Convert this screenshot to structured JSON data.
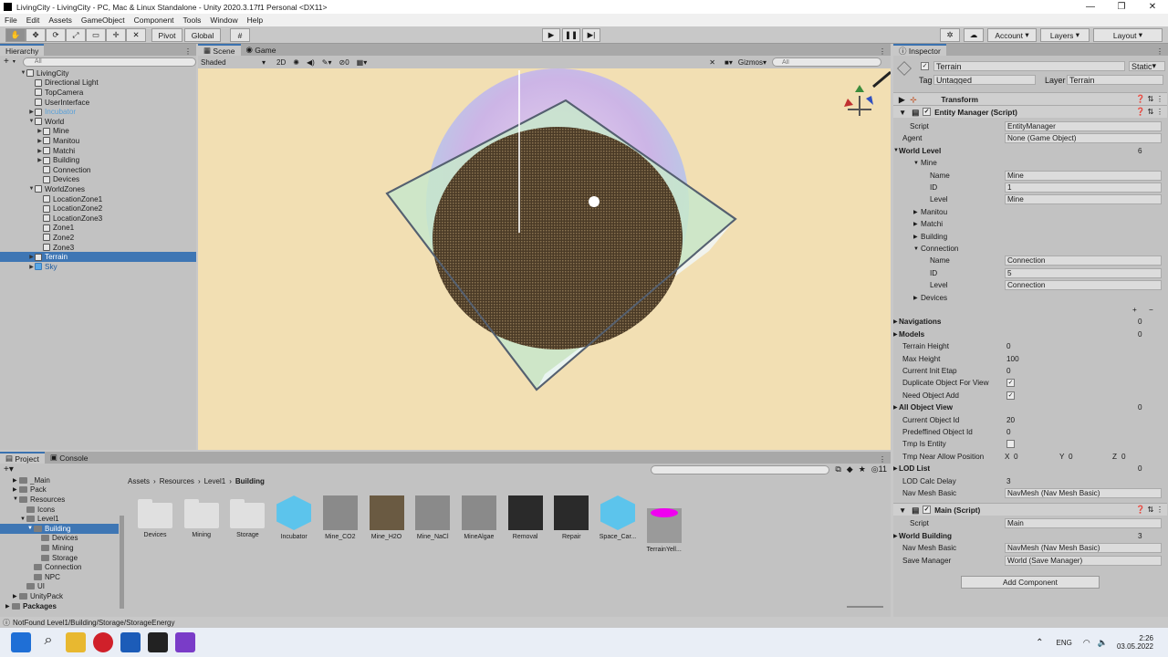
{
  "window": {
    "title": "LivingCity - LivingCity - PC, Mac & Linux Standalone - Unity 2020.3.17f1 Personal <DX11>",
    "minimize": "—",
    "maximize": "❐",
    "close": "✕"
  },
  "menu": [
    "File",
    "Edit",
    "Assets",
    "GameObject",
    "Component",
    "Tools",
    "Window",
    "Help"
  ],
  "toolbar": {
    "pivot": "Pivot",
    "global": "Global",
    "account": "Account",
    "layers": "Layers",
    "layout": "Layout"
  },
  "hierarchy": {
    "tab": "Hierarchy",
    "search_placeholder": "All",
    "rows": [
      {
        "label": "LivingCity",
        "indent": 0,
        "arrow": "▼",
        "type": "scene"
      },
      {
        "label": "Directional Light",
        "indent": 1,
        "arrow": "",
        "type": "obj"
      },
      {
        "label": "TopCamera",
        "indent": 1,
        "arrow": "",
        "type": "obj"
      },
      {
        "label": "UserInterface",
        "indent": 1,
        "arrow": "",
        "type": "obj"
      },
      {
        "label": "Incubator",
        "indent": 1,
        "arrow": "▶",
        "type": "faded"
      },
      {
        "label": "World",
        "indent": 1,
        "arrow": "▼",
        "type": "obj"
      },
      {
        "label": "Mine",
        "indent": 2,
        "arrow": "▶",
        "type": "obj"
      },
      {
        "label": "Manitou",
        "indent": 2,
        "arrow": "▶",
        "type": "obj"
      },
      {
        "label": "Matchi",
        "indent": 2,
        "arrow": "▶",
        "type": "obj"
      },
      {
        "label": "Building",
        "indent": 2,
        "arrow": "▶",
        "type": "obj"
      },
      {
        "label": "Connection",
        "indent": 2,
        "arrow": "",
        "type": "obj"
      },
      {
        "label": "Devices",
        "indent": 2,
        "arrow": "",
        "type": "obj"
      },
      {
        "label": "WorldZones",
        "indent": 1,
        "arrow": "▼",
        "type": "obj"
      },
      {
        "label": "LocationZone1",
        "indent": 2,
        "arrow": "",
        "type": "obj"
      },
      {
        "label": "LocationZone2",
        "indent": 2,
        "arrow": "",
        "type": "obj"
      },
      {
        "label": "LocationZone3",
        "indent": 2,
        "arrow": "",
        "type": "obj"
      },
      {
        "label": "Zone1",
        "indent": 2,
        "arrow": "",
        "type": "obj"
      },
      {
        "label": "Zone2",
        "indent": 2,
        "arrow": "",
        "type": "obj"
      },
      {
        "label": "Zone3",
        "indent": 2,
        "arrow": "",
        "type": "obj"
      },
      {
        "label": "Terrain",
        "indent": 1,
        "arrow": "▶",
        "type": "selected"
      },
      {
        "label": "Sky",
        "indent": 1,
        "arrow": "▶",
        "type": "prefab"
      }
    ]
  },
  "scene": {
    "tab_scene": "Scene",
    "tab_game": "Game",
    "shading": "Shaded",
    "mode_2d": "2D",
    "gizmos": "Gizmos",
    "search_placeholder": "All",
    "hidden_count": "0"
  },
  "inspector": {
    "tab": "Inspector",
    "object_name": "Terrain",
    "static_label": "Static",
    "tag_label": "Tag",
    "tag_value": "Untagged",
    "layer_label": "Layer",
    "layer_value": "Terrain",
    "transform": "Transform",
    "entity_manager": "Entity Manager (Script)",
    "script_label": "Script",
    "script_value": "EntityManager",
    "agent_label": "Agent",
    "agent_value": "None (Game Object)",
    "world_level": "World Level",
    "world_level_count": "6",
    "mine": "Mine",
    "name_label": "Name",
    "id_label": "ID",
    "level_label": "Level",
    "mine_name": "Mine",
    "mine_id": "1",
    "mine_level": "Mine",
    "manitou": "Manitou",
    "matchi": "Matchi",
    "building": "Building",
    "connection": "Connection",
    "conn_name": "Connection",
    "conn_id": "5",
    "conn_level": "Connection",
    "devices": "Devices",
    "plus": "+",
    "minus": "−",
    "navigations": "Navigations",
    "navigations_count": "0",
    "models": "Models",
    "models_count": "0",
    "terrain_height": "Terrain Height",
    "terrain_height_value": "0",
    "max_height": "Max Height",
    "max_height_value": "100",
    "current_init_etap": "Current Init Etap",
    "current_init_etap_value": "0",
    "duplicate_object": "Duplicate Object For View",
    "need_object_add": "Need Object Add",
    "check": "✓",
    "all_object_view": "All Object View",
    "all_object_view_count": "0",
    "current_object_id": "Current Object Id",
    "current_object_id_value": "20",
    "predef_object_id": "Predeffined Object Id",
    "predef_object_id_value": "0",
    "tmp_is_entity": "Tmp Is Entity",
    "tmp_near_allow": "Tmp Near Allow Position",
    "x": "X",
    "y": "Y",
    "z": "Z",
    "zero": "0",
    "lod_list": "LOD List",
    "lod_list_count": "0",
    "lod_calc_delay": "LOD Calc Delay",
    "lod_calc_delay_value": "3",
    "nav_mesh_basic": "Nav Mesh Basic",
    "nav_mesh_basic_value": "NavMesh (Nav Mesh Basic)",
    "main_script": "Main (Script)",
    "main_script_value": "Main",
    "world_building": "World Building",
    "world_building_count": "3",
    "nav_mesh_basic_2_value": "NavMesh (Nav Mesh Basic)",
    "save_manager": "Save Manager",
    "save_manager_value": "World (Save Manager)",
    "add_component": "Add Component"
  },
  "project": {
    "tab_project": "Project",
    "tab_console": "Console",
    "asset_count": "11",
    "breadcrumb": [
      "Assets",
      "Resources",
      "Level1",
      "Building"
    ],
    "tree": [
      {
        "label": "_Main",
        "indent": 1,
        "sel": false
      },
      {
        "label": "Pack",
        "indent": 1,
        "sel": false
      },
      {
        "label": "Resources",
        "indent": 1,
        "sel": false
      },
      {
        "label": "Icons",
        "indent": 2,
        "sel": false
      },
      {
        "label": "Level1",
        "indent": 2,
        "sel": false
      },
      {
        "label": "Building",
        "indent": 3,
        "sel": true
      },
      {
        "label": "Devices",
        "indent": 4,
        "sel": false
      },
      {
        "label": "Mining",
        "indent": 4,
        "sel": false
      },
      {
        "label": "Storage",
        "indent": 4,
        "sel": false
      },
      {
        "label": "Connection",
        "indent": 3,
        "sel": false
      },
      {
        "label": "NPC",
        "indent": 3,
        "sel": false
      },
      {
        "label": "UI",
        "indent": 2,
        "sel": false
      },
      {
        "label": "UnityPack",
        "indent": 1,
        "sel": false
      },
      {
        "label": "Packages",
        "indent": 0,
        "sel": false
      }
    ],
    "assets": [
      {
        "label": "Devices",
        "kind": "folder"
      },
      {
        "label": "Mining",
        "kind": "folder"
      },
      {
        "label": "Storage",
        "kind": "folder"
      },
      {
        "label": "Incubator",
        "kind": "cube"
      },
      {
        "label": "Mine_CO2",
        "kind": "mesh"
      },
      {
        "label": "Mine_H2O",
        "kind": "meshbrown"
      },
      {
        "label": "Mine_NaCl",
        "kind": "mesh"
      },
      {
        "label": "MineAlgae",
        "kind": "mesh"
      },
      {
        "label": "Removal",
        "kind": "box"
      },
      {
        "label": "Repair",
        "kind": "box"
      },
      {
        "label": "Space_Car...",
        "kind": "cube"
      },
      {
        "label": "TerrainYell...",
        "kind": "magenta"
      }
    ]
  },
  "status": {
    "message": "NotFound Level1/Building/Storage/StorageEnergy"
  },
  "taskbar": {
    "lang": "ENG",
    "time": "2:26",
    "date": "03.05.2022"
  }
}
